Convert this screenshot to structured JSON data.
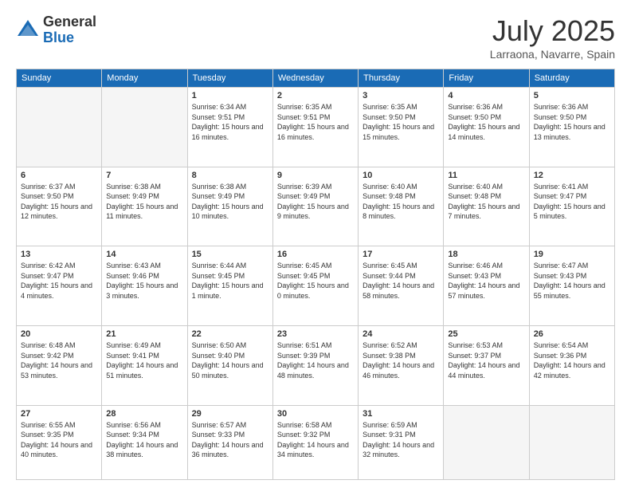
{
  "header": {
    "logo_general": "General",
    "logo_blue": "Blue",
    "month_title": "July 2025",
    "location": "Larraona, Navarre, Spain"
  },
  "days_of_week": [
    "Sunday",
    "Monday",
    "Tuesday",
    "Wednesday",
    "Thursday",
    "Friday",
    "Saturday"
  ],
  "weeks": [
    [
      {
        "day": "",
        "empty": true
      },
      {
        "day": "",
        "empty": true
      },
      {
        "day": "1",
        "sunrise": "Sunrise: 6:34 AM",
        "sunset": "Sunset: 9:51 PM",
        "daylight": "Daylight: 15 hours and 16 minutes."
      },
      {
        "day": "2",
        "sunrise": "Sunrise: 6:35 AM",
        "sunset": "Sunset: 9:51 PM",
        "daylight": "Daylight: 15 hours and 16 minutes."
      },
      {
        "day": "3",
        "sunrise": "Sunrise: 6:35 AM",
        "sunset": "Sunset: 9:50 PM",
        "daylight": "Daylight: 15 hours and 15 minutes."
      },
      {
        "day": "4",
        "sunrise": "Sunrise: 6:36 AM",
        "sunset": "Sunset: 9:50 PM",
        "daylight": "Daylight: 15 hours and 14 minutes."
      },
      {
        "day": "5",
        "sunrise": "Sunrise: 6:36 AM",
        "sunset": "Sunset: 9:50 PM",
        "daylight": "Daylight: 15 hours and 13 minutes."
      }
    ],
    [
      {
        "day": "6",
        "sunrise": "Sunrise: 6:37 AM",
        "sunset": "Sunset: 9:50 PM",
        "daylight": "Daylight: 15 hours and 12 minutes."
      },
      {
        "day": "7",
        "sunrise": "Sunrise: 6:38 AM",
        "sunset": "Sunset: 9:49 PM",
        "daylight": "Daylight: 15 hours and 11 minutes."
      },
      {
        "day": "8",
        "sunrise": "Sunrise: 6:38 AM",
        "sunset": "Sunset: 9:49 PM",
        "daylight": "Daylight: 15 hours and 10 minutes."
      },
      {
        "day": "9",
        "sunrise": "Sunrise: 6:39 AM",
        "sunset": "Sunset: 9:49 PM",
        "daylight": "Daylight: 15 hours and 9 minutes."
      },
      {
        "day": "10",
        "sunrise": "Sunrise: 6:40 AM",
        "sunset": "Sunset: 9:48 PM",
        "daylight": "Daylight: 15 hours and 8 minutes."
      },
      {
        "day": "11",
        "sunrise": "Sunrise: 6:40 AM",
        "sunset": "Sunset: 9:48 PM",
        "daylight": "Daylight: 15 hours and 7 minutes."
      },
      {
        "day": "12",
        "sunrise": "Sunrise: 6:41 AM",
        "sunset": "Sunset: 9:47 PM",
        "daylight": "Daylight: 15 hours and 5 minutes."
      }
    ],
    [
      {
        "day": "13",
        "sunrise": "Sunrise: 6:42 AM",
        "sunset": "Sunset: 9:47 PM",
        "daylight": "Daylight: 15 hours and 4 minutes."
      },
      {
        "day": "14",
        "sunrise": "Sunrise: 6:43 AM",
        "sunset": "Sunset: 9:46 PM",
        "daylight": "Daylight: 15 hours and 3 minutes."
      },
      {
        "day": "15",
        "sunrise": "Sunrise: 6:44 AM",
        "sunset": "Sunset: 9:45 PM",
        "daylight": "Daylight: 15 hours and 1 minute."
      },
      {
        "day": "16",
        "sunrise": "Sunrise: 6:45 AM",
        "sunset": "Sunset: 9:45 PM",
        "daylight": "Daylight: 15 hours and 0 minutes."
      },
      {
        "day": "17",
        "sunrise": "Sunrise: 6:45 AM",
        "sunset": "Sunset: 9:44 PM",
        "daylight": "Daylight: 14 hours and 58 minutes."
      },
      {
        "day": "18",
        "sunrise": "Sunrise: 6:46 AM",
        "sunset": "Sunset: 9:43 PM",
        "daylight": "Daylight: 14 hours and 57 minutes."
      },
      {
        "day": "19",
        "sunrise": "Sunrise: 6:47 AM",
        "sunset": "Sunset: 9:43 PM",
        "daylight": "Daylight: 14 hours and 55 minutes."
      }
    ],
    [
      {
        "day": "20",
        "sunrise": "Sunrise: 6:48 AM",
        "sunset": "Sunset: 9:42 PM",
        "daylight": "Daylight: 14 hours and 53 minutes."
      },
      {
        "day": "21",
        "sunrise": "Sunrise: 6:49 AM",
        "sunset": "Sunset: 9:41 PM",
        "daylight": "Daylight: 14 hours and 51 minutes."
      },
      {
        "day": "22",
        "sunrise": "Sunrise: 6:50 AM",
        "sunset": "Sunset: 9:40 PM",
        "daylight": "Daylight: 14 hours and 50 minutes."
      },
      {
        "day": "23",
        "sunrise": "Sunrise: 6:51 AM",
        "sunset": "Sunset: 9:39 PM",
        "daylight": "Daylight: 14 hours and 48 minutes."
      },
      {
        "day": "24",
        "sunrise": "Sunrise: 6:52 AM",
        "sunset": "Sunset: 9:38 PM",
        "daylight": "Daylight: 14 hours and 46 minutes."
      },
      {
        "day": "25",
        "sunrise": "Sunrise: 6:53 AM",
        "sunset": "Sunset: 9:37 PM",
        "daylight": "Daylight: 14 hours and 44 minutes."
      },
      {
        "day": "26",
        "sunrise": "Sunrise: 6:54 AM",
        "sunset": "Sunset: 9:36 PM",
        "daylight": "Daylight: 14 hours and 42 minutes."
      }
    ],
    [
      {
        "day": "27",
        "sunrise": "Sunrise: 6:55 AM",
        "sunset": "Sunset: 9:35 PM",
        "daylight": "Daylight: 14 hours and 40 minutes."
      },
      {
        "day": "28",
        "sunrise": "Sunrise: 6:56 AM",
        "sunset": "Sunset: 9:34 PM",
        "daylight": "Daylight: 14 hours and 38 minutes."
      },
      {
        "day": "29",
        "sunrise": "Sunrise: 6:57 AM",
        "sunset": "Sunset: 9:33 PM",
        "daylight": "Daylight: 14 hours and 36 minutes."
      },
      {
        "day": "30",
        "sunrise": "Sunrise: 6:58 AM",
        "sunset": "Sunset: 9:32 PM",
        "daylight": "Daylight: 14 hours and 34 minutes."
      },
      {
        "day": "31",
        "sunrise": "Sunrise: 6:59 AM",
        "sunset": "Sunset: 9:31 PM",
        "daylight": "Daylight: 14 hours and 32 minutes."
      },
      {
        "day": "",
        "empty": true
      },
      {
        "day": "",
        "empty": true
      }
    ]
  ]
}
